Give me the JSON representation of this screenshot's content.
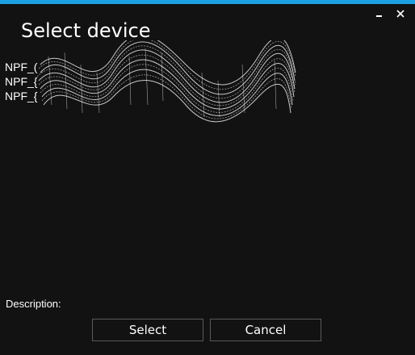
{
  "window": {
    "title": "Select device",
    "accent_color": "#1ba1e2",
    "background_color": "#121212",
    "controls": {
      "minimize_icon": "minimize-icon",
      "close_icon": "close-icon"
    }
  },
  "device_list": {
    "items": [
      {
        "label": "NPF_("
      },
      {
        "label": "NPF_{"
      },
      {
        "label": "NPF_{"
      }
    ],
    "redaction_note_icon": "redaction-scribble"
  },
  "footer": {
    "description_label": "Description:",
    "select_label": "Select",
    "cancel_label": "Cancel"
  }
}
